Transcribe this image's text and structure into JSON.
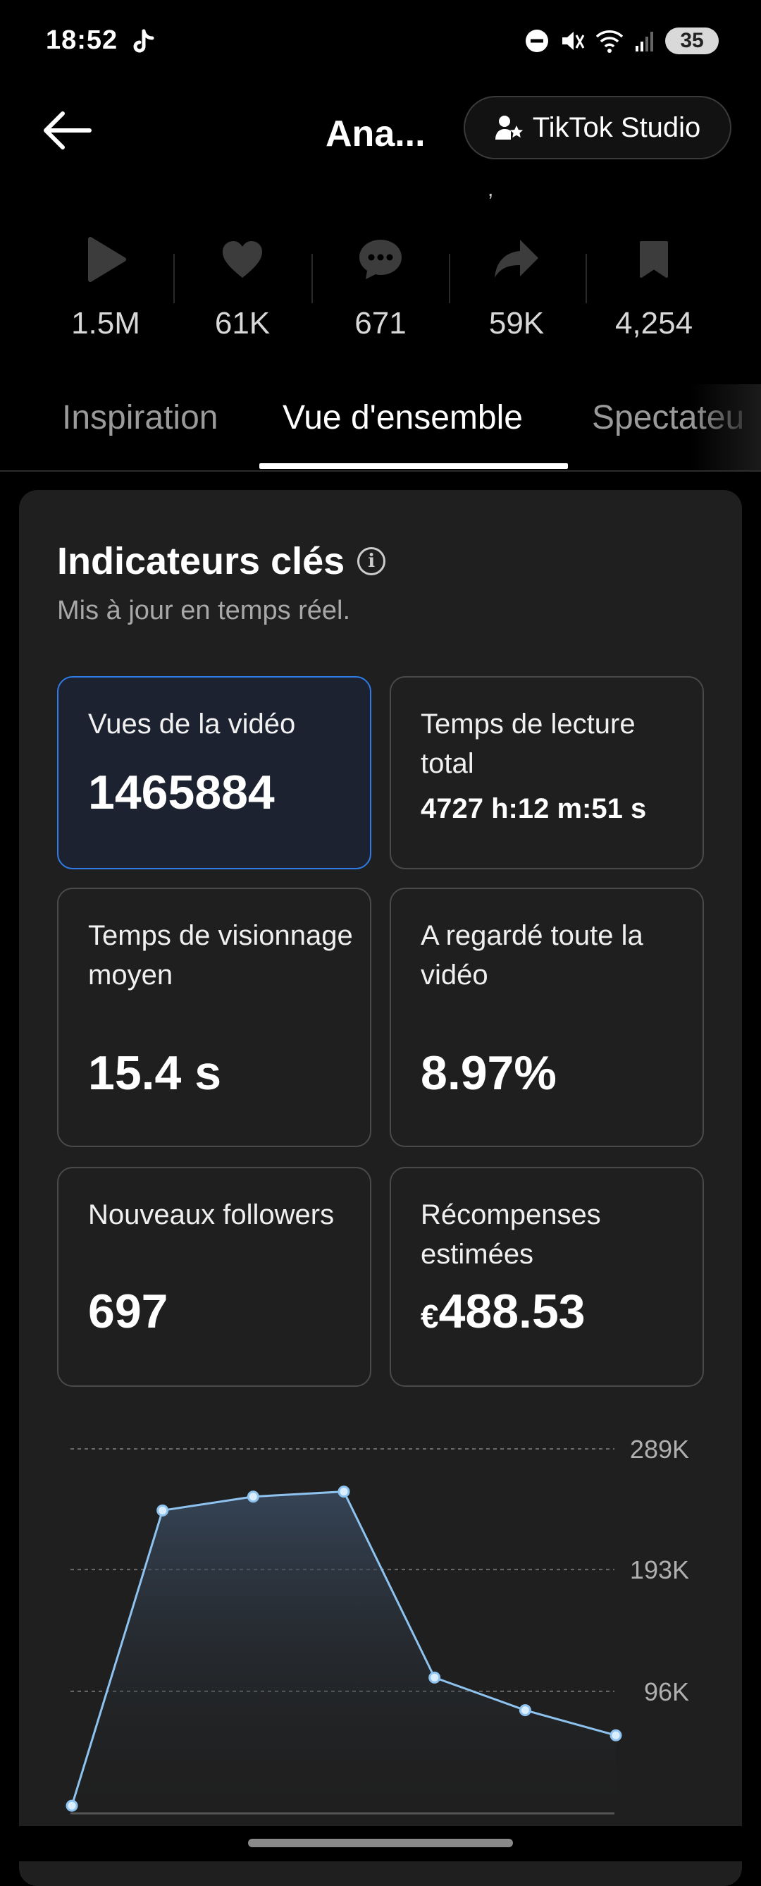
{
  "status_bar": {
    "time": "18:52",
    "battery": "35"
  },
  "header": {
    "title": "Ana...",
    "studio_button": "TikTok Studio"
  },
  "stats": [
    {
      "icon": "play-icon",
      "value": "1.5M"
    },
    {
      "icon": "heart-icon",
      "value": "61K"
    },
    {
      "icon": "comment-icon",
      "value": "671"
    },
    {
      "icon": "share-icon",
      "value": "59K"
    },
    {
      "icon": "bookmark-icon",
      "value": "4,254"
    }
  ],
  "tabs": [
    {
      "label": "Inspiration",
      "active": false
    },
    {
      "label": "Vue d'ensemble",
      "active": true
    },
    {
      "label": "Spectateu",
      "active": false
    }
  ],
  "key_metrics": {
    "title": "Indicateurs clés",
    "subtitle": "Mis à jour en temps réel.",
    "items": [
      {
        "label": "Vues de la vidéo",
        "value": "1465884",
        "selected": true
      },
      {
        "label": "Temps de lecture total",
        "value": "4727 h:12 m:51 s",
        "selected": false
      },
      {
        "label": "Temps de visionnage moyen",
        "value": "15.4 s",
        "selected": false
      },
      {
        "label": "A regardé toute la vidéo",
        "value": "8.97%",
        "selected": false
      },
      {
        "label": "Nouveaux followers",
        "value": "697",
        "selected": false
      },
      {
        "label": "Récompenses estimées",
        "currency": "€",
        "value": "488.53",
        "selected": false
      }
    ]
  },
  "chart_data": {
    "type": "area",
    "y_ticks": [
      "289K",
      "193K",
      "96K"
    ],
    "ylim": [
      0,
      289000
    ],
    "x": [
      1,
      2,
      3,
      4,
      5,
      6,
      7
    ],
    "values": [
      5000,
      240000,
      251000,
      255000,
      107000,
      81000,
      61000
    ],
    "grid": true,
    "line_color": "#8ec3f0"
  }
}
